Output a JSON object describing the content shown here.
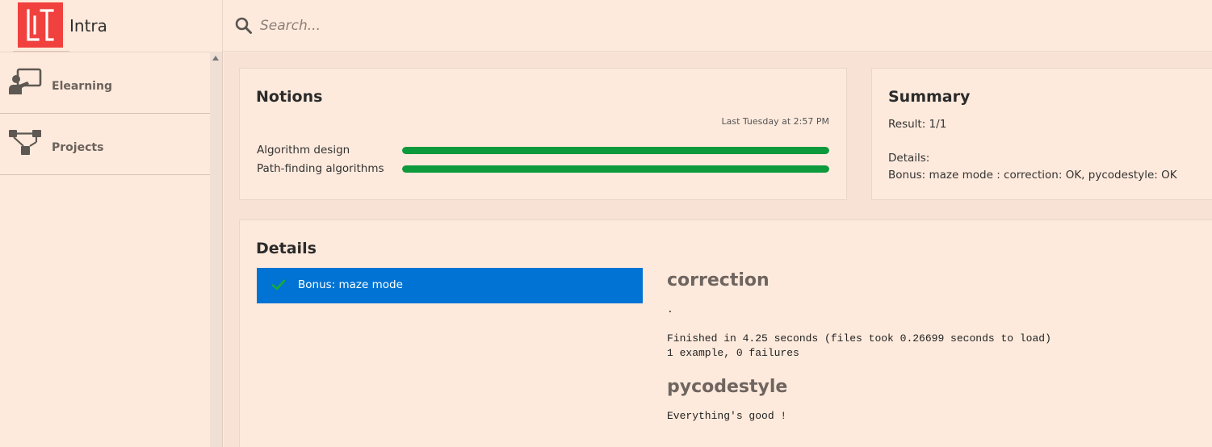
{
  "brand": {
    "name": "Intra",
    "logo_color": "#f0413e"
  },
  "search": {
    "placeholder": "Search..."
  },
  "sidebar": {
    "items": [
      {
        "label": "Elearning",
        "icon": "elearning-icon"
      },
      {
        "label": "Projects",
        "icon": "projects-icon"
      }
    ]
  },
  "notions": {
    "title": "Notions",
    "timestamp": "Last Tuesday at 2:57 PM",
    "items": [
      {
        "label": "Algorithm design",
        "progress": 1.0
      },
      {
        "label": "Path-finding algorithms",
        "progress": 1.0
      }
    ],
    "bar_color": "#0c9a3c"
  },
  "summary": {
    "title": "Summary",
    "result": "Result: 1/1",
    "details_label": "Details:",
    "details_text": "Bonus: maze mode : correction: OK, pycodestyle: OK"
  },
  "details": {
    "title": "Details",
    "tests": [
      {
        "label": "Bonus: maze mode",
        "status": "passed",
        "icon": "check-icon"
      }
    ],
    "selected_color": "#0073d4",
    "results": [
      {
        "heading": "correction",
        "output": ".\n\nFinished in 4.25 seconds (files took 0.26699 seconds to load)\n1 example, 0 failures"
      },
      {
        "heading": "pycodestyle",
        "output": "Everything's good !"
      }
    ]
  }
}
